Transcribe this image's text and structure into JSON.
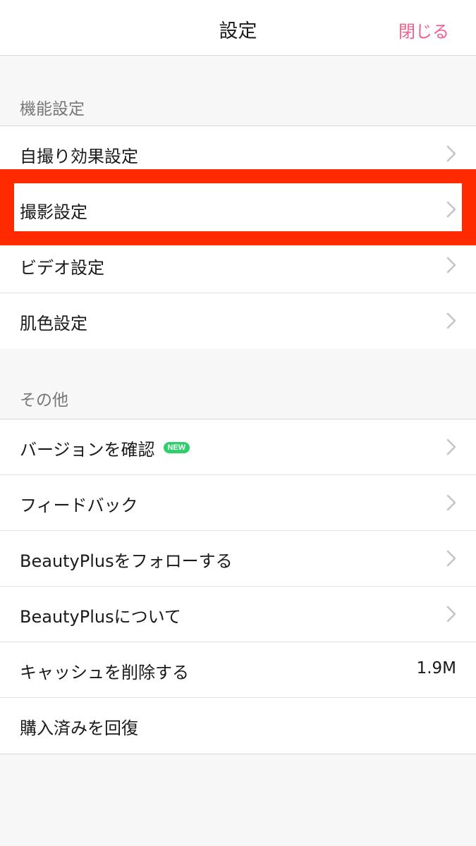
{
  "nav": {
    "title": "設定",
    "close_label": "閉じる"
  },
  "sections": [
    {
      "label": "機能設定",
      "items": [
        {
          "label": "自撮り効果設定"
        },
        {
          "label": "撮影設定"
        },
        {
          "label": "ビデオ設定"
        },
        {
          "label": "肌色設定"
        }
      ]
    },
    {
      "label": "その他",
      "items": [
        {
          "label": "バージョンを確認",
          "badge": "NEW"
        },
        {
          "label": "フィードバック"
        },
        {
          "label": "BeautyPlusをフォローする"
        },
        {
          "label": "BeautyPlusについて"
        },
        {
          "label": "キャッシュを削除する",
          "value": "1.9M"
        },
        {
          "label": "購入済みを回復"
        }
      ]
    }
  ],
  "icons": {
    "row_chevron": "chevron-right-icon"
  },
  "colors": {
    "accent": "#f0608a",
    "highlight": "#ff2a00",
    "badge": "#2fcf6b"
  }
}
